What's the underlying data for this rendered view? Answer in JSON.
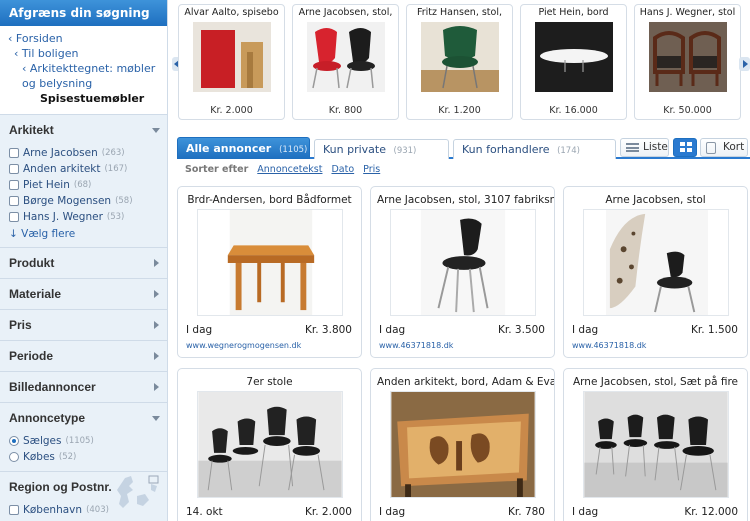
{
  "sidebar": {
    "title": "Afgræns din søgning",
    "breadcrumbs": [
      "Forsiden",
      "Til boligen",
      "Arkitekttegnet: møbler og belysning",
      "Spisestuemøbler"
    ],
    "arkitekt": {
      "title": "Arkitekt",
      "options": [
        {
          "label": "Arne Jacobsen",
          "count": "(263)"
        },
        {
          "label": "Anden arkitekt",
          "count": "(167)"
        },
        {
          "label": "Piet Hein",
          "count": "(68)"
        },
        {
          "label": "Børge Mogensen",
          "count": "(58)"
        },
        {
          "label": "Hans J. Wegner",
          "count": "(53)"
        }
      ],
      "more": "Vælg flere"
    },
    "sections": [
      "Produkt",
      "Materiale",
      "Pris",
      "Periode",
      "Billedannoncer"
    ],
    "annoncetype": {
      "title": "Annoncetype",
      "options": [
        {
          "label": "Sælges",
          "count": "(1105)",
          "selected": true
        },
        {
          "label": "Købes",
          "count": "(52)",
          "selected": false
        }
      ]
    },
    "region": {
      "title": "Region og Postnr.",
      "options": [
        {
          "label": "København",
          "count": "(403)"
        }
      ]
    }
  },
  "carousel": [
    {
      "title": "Alvar Aalto, spisebo",
      "price": "Kr. 2.000"
    },
    {
      "title": "Arne Jacobsen, stol,",
      "price": "Kr. 800"
    },
    {
      "title": "Fritz Hansen, stol,",
      "price": "Kr. 1.200"
    },
    {
      "title": "Piet Hein, bord",
      "price": "Kr. 16.000"
    },
    {
      "title": "Hans J. Wegner, stol",
      "price": "Kr. 50.000"
    }
  ],
  "tabs": [
    {
      "label": "Alle annoncer",
      "count": "(1105)"
    },
    {
      "label": "Kun private",
      "count": "(931)"
    },
    {
      "label": "Kun forhandlere",
      "count": "(174)"
    }
  ],
  "view": {
    "list": "Liste",
    "map": "Kort"
  },
  "sort": {
    "label": "Sorter efter",
    "options": [
      "Annoncetekst",
      "Dato",
      "Pris"
    ]
  },
  "listings": [
    {
      "title": "Brdr-Andersen, bord Bådformet",
      "date": "I dag",
      "price": "Kr. 3.800",
      "link": "www.wegnerogmogensen.dk"
    },
    {
      "title": "Arne Jacobsen, stol, 3107 fabriksny",
      "date": "I dag",
      "price": "Kr. 3.500",
      "link": "www.46371818.dk"
    },
    {
      "title": "Arne Jacobsen, stol",
      "date": "I dag",
      "price": "Kr. 1.500",
      "link": "www.46371818.dk"
    },
    {
      "title": "7er stole",
      "date": "14. okt",
      "price": "Kr. 2.000",
      "link": ""
    },
    {
      "title": "Anden arkitekt, bord, Adam & Eva,",
      "date": "I dag",
      "price": "Kr. 780",
      "link": ""
    },
    {
      "title": "Arne Jacobsen, stol, Sæt på fire",
      "date": "I dag",
      "price": "Kr. 12.000",
      "link": ""
    }
  ],
  "colors": {
    "accent": "#1e6fbf",
    "link": "#2a62a8",
    "sidebar_bg": "#e9f1f8"
  }
}
